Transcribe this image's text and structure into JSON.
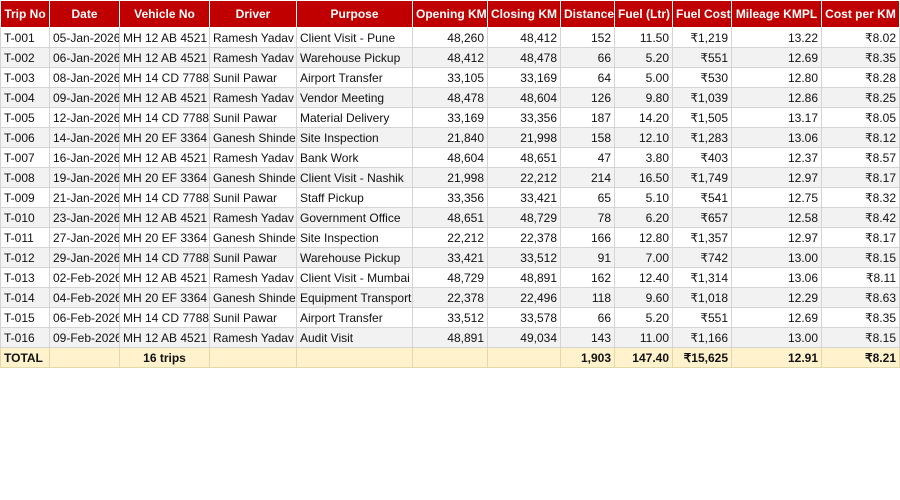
{
  "headers": [
    "Trip No",
    "Date",
    "Vehicle No",
    "Driver",
    "Purpose",
    "Opening KM",
    "Closing KM",
    "Distance",
    "Fuel (Ltr)",
    "Fuel Cost",
    "Mileage KMPL",
    "Cost per KM"
  ],
  "rows": [
    [
      "T-001",
      "05-Jan-2026",
      "MH 12 AB 4521",
      "Ramesh Yadav",
      "Client Visit - Pune",
      "48,260",
      "48,412",
      "152",
      "11.50",
      "₹1,219",
      "13.22",
      "₹8.02"
    ],
    [
      "T-002",
      "06-Jan-2026",
      "MH 12 AB 4521",
      "Ramesh Yadav",
      "Warehouse Pickup",
      "48,412",
      "48,478",
      "66",
      "5.20",
      "₹551",
      "12.69",
      "₹8.35"
    ],
    [
      "T-003",
      "08-Jan-2026",
      "MH 14 CD 7788",
      "Sunil Pawar",
      "Airport Transfer",
      "33,105",
      "33,169",
      "64",
      "5.00",
      "₹530",
      "12.80",
      "₹8.28"
    ],
    [
      "T-004",
      "09-Jan-2026",
      "MH 12 AB 4521",
      "Ramesh Yadav",
      "Vendor Meeting",
      "48,478",
      "48,604",
      "126",
      "9.80",
      "₹1,039",
      "12.86",
      "₹8.25"
    ],
    [
      "T-005",
      "12-Jan-2026",
      "MH 14 CD 7788",
      "Sunil Pawar",
      "Material Delivery",
      "33,169",
      "33,356",
      "187",
      "14.20",
      "₹1,505",
      "13.17",
      "₹8.05"
    ],
    [
      "T-006",
      "14-Jan-2026",
      "MH 20 EF 3364",
      "Ganesh Shinde",
      "Site Inspection",
      "21,840",
      "21,998",
      "158",
      "12.10",
      "₹1,283",
      "13.06",
      "₹8.12"
    ],
    [
      "T-007",
      "16-Jan-2026",
      "MH 12 AB 4521",
      "Ramesh Yadav",
      "Bank Work",
      "48,604",
      "48,651",
      "47",
      "3.80",
      "₹403",
      "12.37",
      "₹8.57"
    ],
    [
      "T-008",
      "19-Jan-2026",
      "MH 20 EF 3364",
      "Ganesh Shinde",
      "Client Visit - Nashik",
      "21,998",
      "22,212",
      "214",
      "16.50",
      "₹1,749",
      "12.97",
      "₹8.17"
    ],
    [
      "T-009",
      "21-Jan-2026",
      "MH 14 CD 7788",
      "Sunil Pawar",
      "Staff Pickup",
      "33,356",
      "33,421",
      "65",
      "5.10",
      "₹541",
      "12.75",
      "₹8.32"
    ],
    [
      "T-010",
      "23-Jan-2026",
      "MH 12 AB 4521",
      "Ramesh Yadav",
      "Government Office",
      "48,651",
      "48,729",
      "78",
      "6.20",
      "₹657",
      "12.58",
      "₹8.42"
    ],
    [
      "T-011",
      "27-Jan-2026",
      "MH 20 EF 3364",
      "Ganesh Shinde",
      "Site Inspection",
      "22,212",
      "22,378",
      "166",
      "12.80",
      "₹1,357",
      "12.97",
      "₹8.17"
    ],
    [
      "T-012",
      "29-Jan-2026",
      "MH 14 CD 7788",
      "Sunil Pawar",
      "Warehouse Pickup",
      "33,421",
      "33,512",
      "91",
      "7.00",
      "₹742",
      "13.00",
      "₹8.15"
    ],
    [
      "T-013",
      "02-Feb-2026",
      "MH 12 AB 4521",
      "Ramesh Yadav",
      "Client Visit - Mumbai",
      "48,729",
      "48,891",
      "162",
      "12.40",
      "₹1,314",
      "13.06",
      "₹8.11"
    ],
    [
      "T-014",
      "04-Feb-2026",
      "MH 20 EF 3364",
      "Ganesh Shinde",
      "Equipment Transport",
      "22,378",
      "22,496",
      "118",
      "9.60",
      "₹1,018",
      "12.29",
      "₹8.63"
    ],
    [
      "T-015",
      "06-Feb-2026",
      "MH 14 CD 7788",
      "Sunil Pawar",
      "Airport Transfer",
      "33,512",
      "33,578",
      "66",
      "5.20",
      "₹551",
      "12.69",
      "₹8.35"
    ],
    [
      "T-016",
      "09-Feb-2026",
      "MH 12 AB 4521",
      "Ramesh Yadav",
      "Audit Visit",
      "48,891",
      "49,034",
      "143",
      "11.00",
      "₹1,166",
      "13.00",
      "₹8.15"
    ]
  ],
  "total": {
    "label": "TOTAL",
    "trips": "16 trips",
    "distance": "1,903",
    "fuel": "147.40",
    "fuel_cost": "₹15,625",
    "mileage": "12.91",
    "cost_per_km": "₹8.21"
  },
  "colors": {
    "header_bg": "#c00000",
    "header_text": "#ffffff",
    "total_bg": "#fff2cc",
    "zebra": "#f2f2f2"
  }
}
